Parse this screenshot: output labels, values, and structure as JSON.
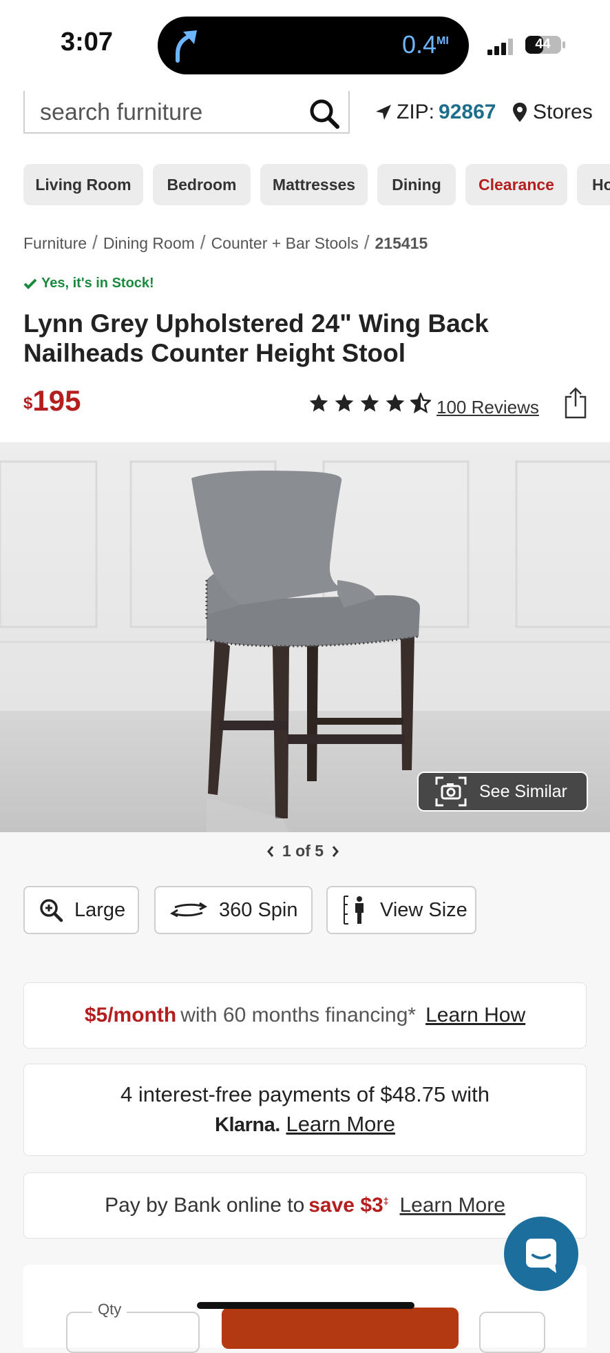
{
  "status_bar": {
    "time": "3:07",
    "distance": "0.4",
    "distance_unit": "MI",
    "battery": "44"
  },
  "header": {
    "search_placeholder": "search furniture",
    "zip_label": "ZIP:",
    "zip_code": "92867",
    "stores_label": "Stores"
  },
  "categories": [
    "Living Room",
    "Bedroom",
    "Mattresses",
    "Dining",
    "Clearance",
    "Ho"
  ],
  "breadcrumb": [
    "Furniture",
    "Dining Room",
    "Counter + Bar Stools",
    "215415"
  ],
  "breadcrumb_separator": "/",
  "stock_status": "Yes, it's in Stock!",
  "product": {
    "title": "Lynn Grey Upholstered 24\" Wing Back Nailheads Counter Height Stool",
    "price_currency": "$",
    "price": "195",
    "rating": 4.5,
    "reviews_label": "100 Reviews"
  },
  "gallery": {
    "see_similar": "See Similar",
    "pager": "1 of 5"
  },
  "view_buttons": {
    "large": "Large",
    "spin": "360 Spin",
    "size": "View Size"
  },
  "financing": {
    "amount": "$5/month",
    "text": "with 60 months financing*",
    "link": "Learn How"
  },
  "klarna": {
    "line1": "4 interest-free payments of $48.75 with",
    "brand": "Klarna.",
    "link": "Learn More"
  },
  "bank": {
    "text": "Pay by Bank online to",
    "save": "save $3",
    "mark": "‡",
    "link": "Learn More"
  },
  "purchase": {
    "qty_label": "Qty"
  },
  "colors": {
    "accent_red": "#b41e1e",
    "link_blue": "#1c6e8c",
    "stock_green": "#1a8a3e",
    "chat_blue": "#1c6e9c"
  }
}
